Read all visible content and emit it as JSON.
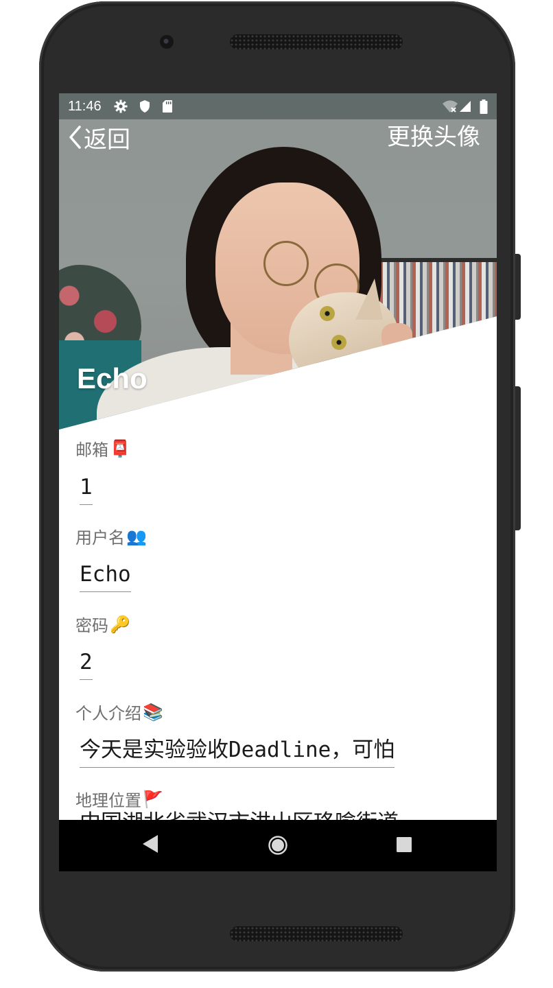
{
  "status_bar": {
    "time": "11:46",
    "left_icons": [
      "gear-icon",
      "shield-icon",
      "sd-card-icon"
    ],
    "right_icons": [
      "wifi-off-icon",
      "signal-icon",
      "battery-icon"
    ]
  },
  "action_bar": {
    "back_label": "返回",
    "change_avatar_label": "更换头像"
  },
  "profile": {
    "display_name": "Echo"
  },
  "fields": [
    {
      "label": "邮箱",
      "emoji": "📮",
      "value": "1"
    },
    {
      "label": "用户名",
      "emoji": "👥",
      "value": "Echo"
    },
    {
      "label": "密码",
      "emoji": "🔑",
      "value": "2"
    },
    {
      "label": "个人介绍",
      "emoji": "📚",
      "value": "今天是实验验收Deadline，可怕"
    },
    {
      "label": "地理位置",
      "emoji": "🚩",
      "value": "中国湖北省武汉市洪山区珞喻街道"
    }
  ],
  "nav_bar": {
    "buttons": [
      "back-triangle-icon",
      "home-circle-icon",
      "recents-square-icon"
    ]
  }
}
